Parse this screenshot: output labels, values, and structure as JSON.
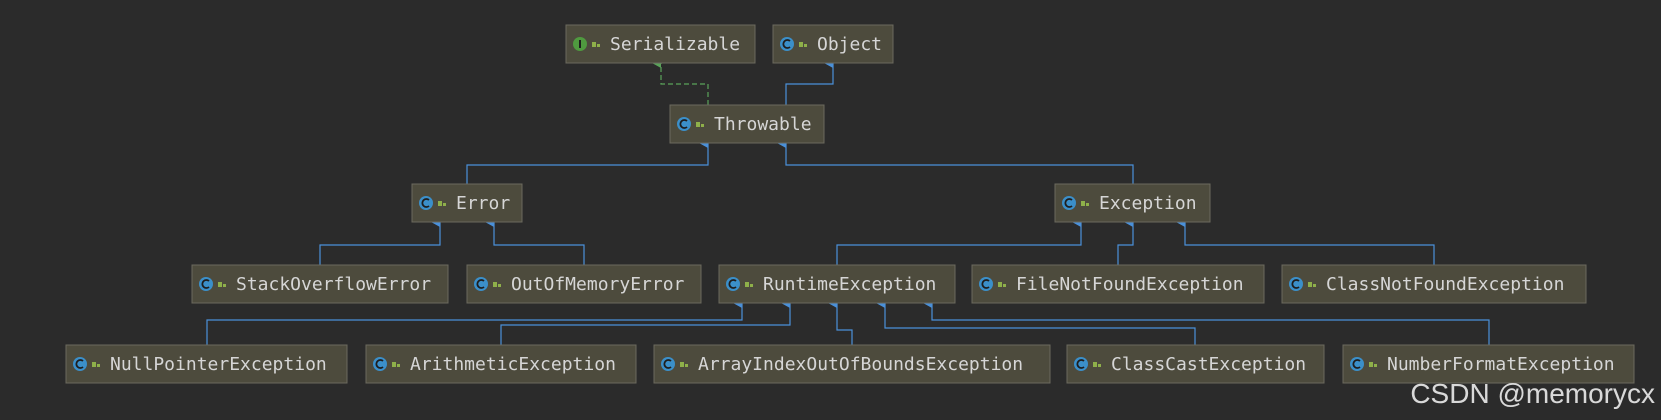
{
  "colors": {
    "background": "#2b2b2b",
    "node_fill": "#4d4b3d",
    "node_border": "#6b6a5e",
    "node_text": "#d6d6d6",
    "extends_edge": "#4a90d9",
    "implements_edge": "#5aa35a",
    "class_icon": "#3b8fc9",
    "interface_icon": "#4f9a3f",
    "access_icon": "#8fb04a"
  },
  "nodes": [
    {
      "id": "serializable",
      "label": "Serializable",
      "kind": "interface",
      "icon": "interface-icon"
    },
    {
      "id": "object",
      "label": "Object",
      "kind": "class",
      "icon": "class-icon"
    },
    {
      "id": "throwable",
      "label": "Throwable",
      "kind": "class",
      "icon": "class-icon"
    },
    {
      "id": "error",
      "label": "Error",
      "kind": "class",
      "icon": "class-icon"
    },
    {
      "id": "exception",
      "label": "Exception",
      "kind": "class",
      "icon": "class-icon"
    },
    {
      "id": "stackoverflowerror",
      "label": "StackOverflowError",
      "kind": "class",
      "icon": "class-icon"
    },
    {
      "id": "outofmemoryerror",
      "label": "OutOfMemoryError",
      "kind": "class",
      "icon": "class-icon"
    },
    {
      "id": "runtimeexception",
      "label": "RuntimeException",
      "kind": "class",
      "icon": "class-icon"
    },
    {
      "id": "filenotfoundexception",
      "label": "FileNotFoundException",
      "kind": "class",
      "icon": "class-icon"
    },
    {
      "id": "classnotfoundexception",
      "label": "ClassNotFoundException",
      "kind": "class",
      "icon": "class-icon"
    },
    {
      "id": "nullpointerexception",
      "label": "NullPointerException",
      "kind": "class",
      "icon": "class-icon"
    },
    {
      "id": "arithmeticexception",
      "label": "ArithmeticException",
      "kind": "class",
      "icon": "class-icon"
    },
    {
      "id": "arrayindexoutofboundsexception",
      "label": "ArrayIndexOutOfBoundsException",
      "kind": "class",
      "icon": "class-icon"
    },
    {
      "id": "classcastexception",
      "label": "ClassCastException",
      "kind": "class",
      "icon": "class-icon"
    },
    {
      "id": "numberformatexception",
      "label": "NumberFormatException",
      "kind": "class",
      "icon": "class-icon"
    }
  ],
  "edges": [
    {
      "from": "throwable",
      "to": "serializable",
      "type": "implements"
    },
    {
      "from": "throwable",
      "to": "object",
      "type": "extends"
    },
    {
      "from": "error",
      "to": "throwable",
      "type": "extends"
    },
    {
      "from": "exception",
      "to": "throwable",
      "type": "extends"
    },
    {
      "from": "stackoverflowerror",
      "to": "error",
      "type": "extends"
    },
    {
      "from": "outofmemoryerror",
      "to": "error",
      "type": "extends"
    },
    {
      "from": "runtimeexception",
      "to": "exception",
      "type": "extends"
    },
    {
      "from": "filenotfoundexception",
      "to": "exception",
      "type": "extends"
    },
    {
      "from": "classnotfoundexception",
      "to": "exception",
      "type": "extends"
    },
    {
      "from": "nullpointerexception",
      "to": "runtimeexception",
      "type": "extends"
    },
    {
      "from": "arithmeticexception",
      "to": "runtimeexception",
      "type": "extends"
    },
    {
      "from": "arrayindexoutofboundsexception",
      "to": "runtimeexception",
      "type": "extends"
    },
    {
      "from": "classcastexception",
      "to": "runtimeexception",
      "type": "extends"
    },
    {
      "from": "numberformatexception",
      "to": "runtimeexception",
      "type": "extends"
    }
  ],
  "watermark": "CSDN @memorycx"
}
